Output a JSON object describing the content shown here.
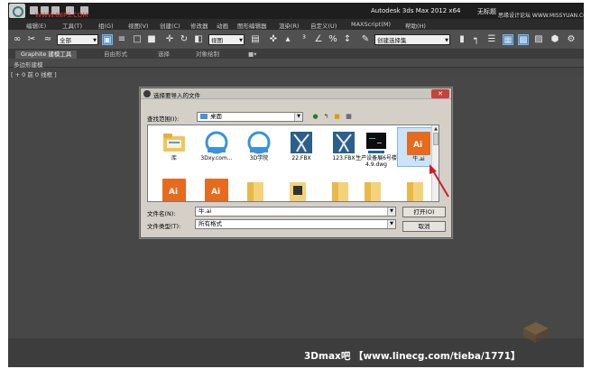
{
  "window": {
    "title": "Autodesk 3ds Max  2012 x64",
    "title_suffix": "无标题",
    "watermark_left": "WWW.68PS.COM",
    "watermark_right": "思缘设计论坛 WWW.MISSYUAN.COM"
  },
  "menu": {
    "items": [
      "编辑(E)",
      "工具(T)",
      "组(G)",
      "视图(V)",
      "创建(C)",
      "修改器",
      "动画",
      "图形编辑器",
      "渲染(R)",
      "自定义(U)",
      "MAXScript(M)",
      "帮助(H)"
    ]
  },
  "toolbar": {
    "selection_filter": "全部",
    "reference_coord": "视图",
    "named_selection_placeholder": "创建选择集"
  },
  "ribbon": {
    "tabs": [
      "Graphite 建模工具",
      "自由形式",
      "选择",
      "对象绘制"
    ],
    "sub_label": "多边形建模"
  },
  "viewport": {
    "label": "[ + 0 前 0 线框 ]"
  },
  "dialog": {
    "title": "选择要导入的文件",
    "look_in_label": "查找范围(I):",
    "look_in_value": "桌面",
    "files": [
      {
        "name": "库",
        "icon": "library-folder-icon"
      },
      {
        "name": "3Dxy.com...",
        "icon": "cloud-shortcut-icon"
      },
      {
        "name": "3D学院",
        "icon": "cloud-shortcut-icon"
      },
      {
        "name": "22.FBX",
        "icon": "fbx-file-icon"
      },
      {
        "name": "123.FBX",
        "icon": "fbx-file-icon"
      },
      {
        "name": "生产设备展6号楼4.9.dwg",
        "icon": "dwg-file-icon"
      },
      {
        "name": "牛.ai",
        "icon": "ai-file-icon"
      }
    ],
    "filename_label": "文件名(N):",
    "filename_value": "牛.ai",
    "filetype_label": "文件类型(T):",
    "filetype_value": "所有格式",
    "open_button": "打开(O)",
    "cancel_button": "取消"
  },
  "footer": {
    "promo": "3Dmax吧 【www.linecg.com/tieba/1771】"
  },
  "colors": {
    "accent": "#3f86c8",
    "ai_orange": "#e66b1e",
    "arrow_red": "#c8202a"
  }
}
